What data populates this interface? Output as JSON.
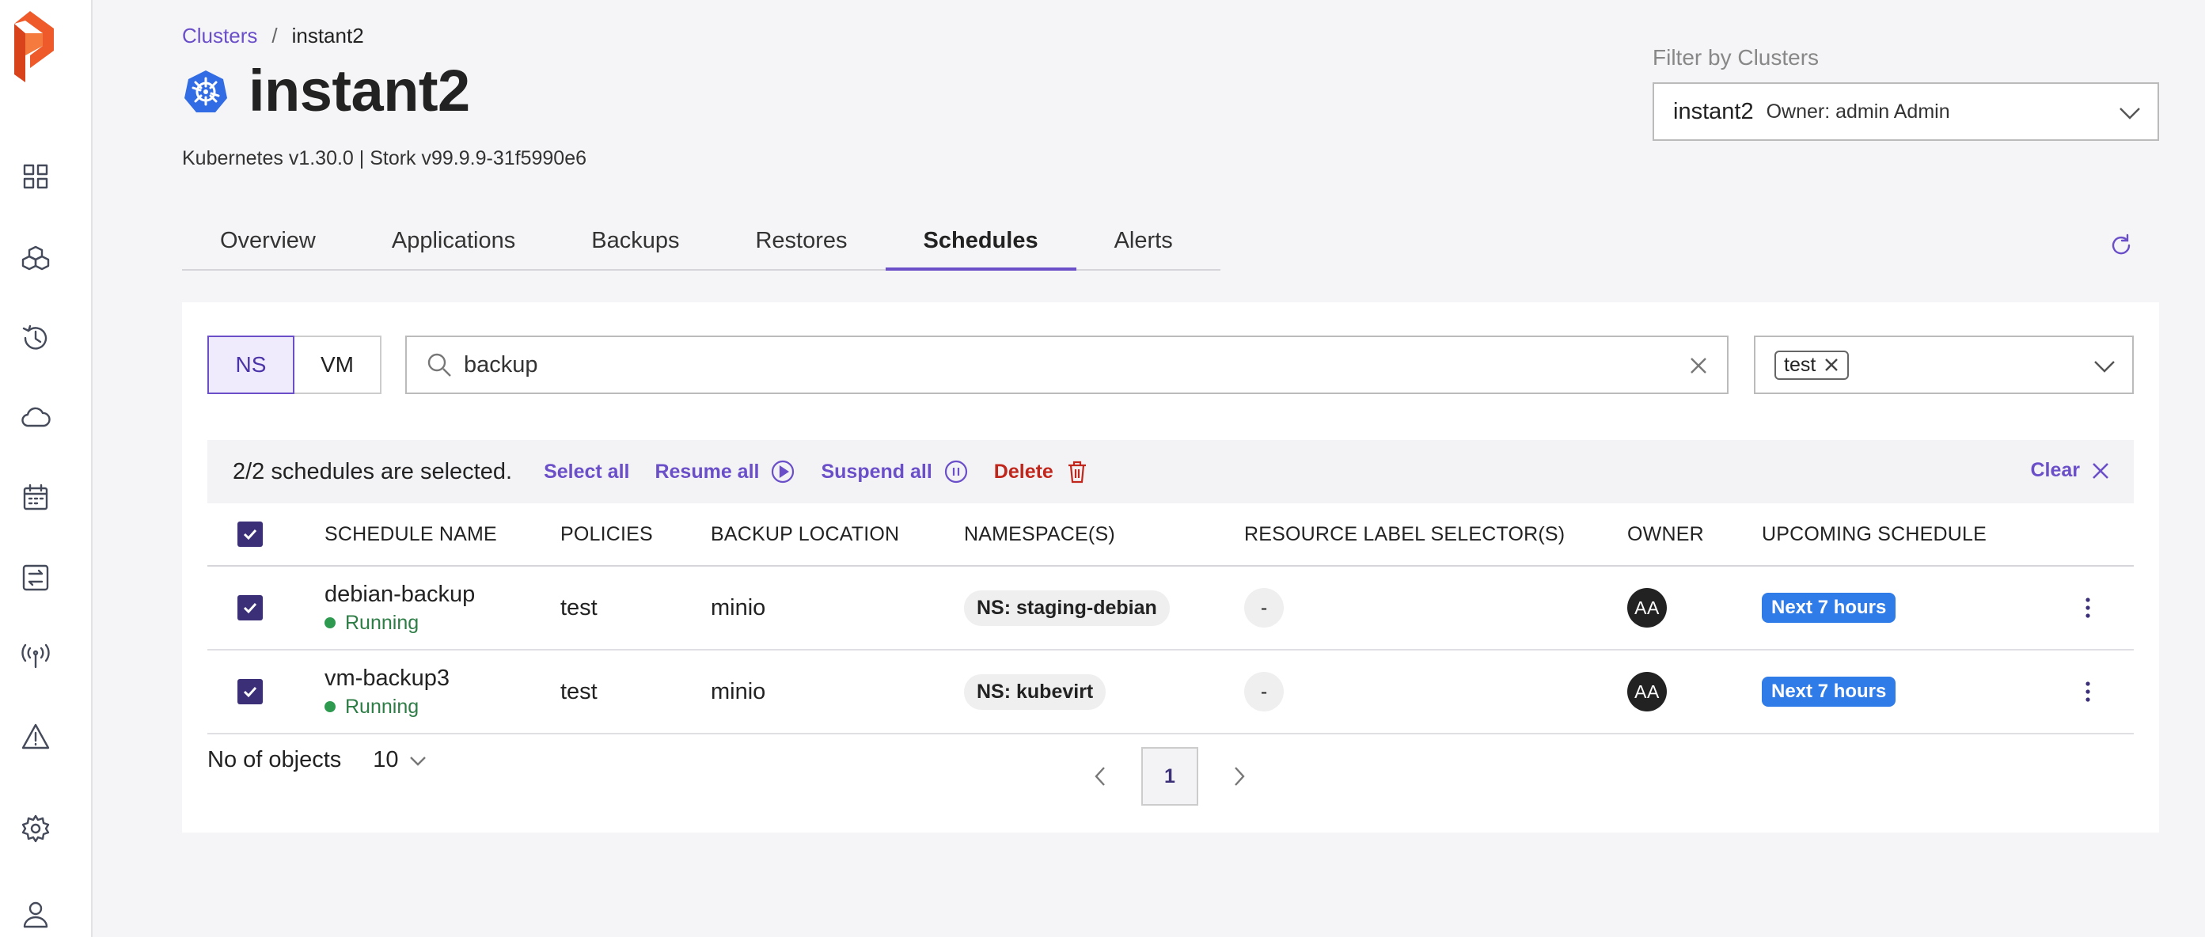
{
  "breadcrumb": {
    "parent": "Clusters",
    "separator": "/",
    "current": "instant2"
  },
  "header": {
    "title": "instant2",
    "version_line": "Kubernetes v1.30.0 | Stork v99.9.9-31f5990e6"
  },
  "cluster_filter": {
    "label": "Filter by Clusters",
    "selected_cluster": "instant2",
    "owner": "Owner: admin Admin"
  },
  "tabs": [
    {
      "label": "Overview"
    },
    {
      "label": "Applications"
    },
    {
      "label": "Backups"
    },
    {
      "label": "Restores"
    },
    {
      "label": "Schedules",
      "active": true
    },
    {
      "label": "Alerts"
    }
  ],
  "toggle": {
    "ns": "NS",
    "vm": "VM",
    "active": "NS"
  },
  "search": {
    "value": "backup",
    "placeholder": "Search"
  },
  "policy_filter": {
    "chip": "test"
  },
  "selection_bar": {
    "text": "2/2 schedules are selected.",
    "select_all": "Select all",
    "resume_all": "Resume all",
    "suspend_all": "Suspend all",
    "delete": "Delete",
    "clear": "Clear"
  },
  "table": {
    "columns": [
      "SCHEDULE NAME",
      "POLICIES",
      "BACKUP LOCATION",
      "NAMESPACE(S)",
      "RESOURCE LABEL SELECTOR(S)",
      "OWNER",
      "UPCOMING SCHEDULE"
    ],
    "rows": [
      {
        "name": "debian-backup",
        "status": "Running",
        "policy": "test",
        "location": "minio",
        "namespace": "NS: staging-debian",
        "label_selector": "-",
        "owner": "AA",
        "upcoming": "Next 7 hours"
      },
      {
        "name": "vm-backup3",
        "status": "Running",
        "policy": "test",
        "location": "minio",
        "namespace": "NS: kubevirt",
        "label_selector": "-",
        "owner": "AA",
        "upcoming": "Next 7 hours"
      }
    ]
  },
  "pagination": {
    "label": "No of objects",
    "per_page": "10",
    "current_page": "1"
  },
  "colors": {
    "accent": "#6a4fc9",
    "danger": "#c0261b",
    "running": "#2e7d46",
    "badge": "#2f7ce8"
  },
  "icons": [
    "portworx-logo",
    "dashboard-icon",
    "applications-icon",
    "backups-history-icon",
    "cloud-icon",
    "calendar-icon",
    "migration-icon",
    "antenna-icon",
    "alert-icon",
    "settings-icon",
    "user-icon",
    "kubernetes-icon",
    "refresh-icon",
    "search-icon",
    "clear-icon",
    "play-circle-icon",
    "pause-circle-icon",
    "trash-icon",
    "close-icon",
    "kebab-icon",
    "chevron-down-icon",
    "chevron-left-icon",
    "chevron-right-icon"
  ]
}
